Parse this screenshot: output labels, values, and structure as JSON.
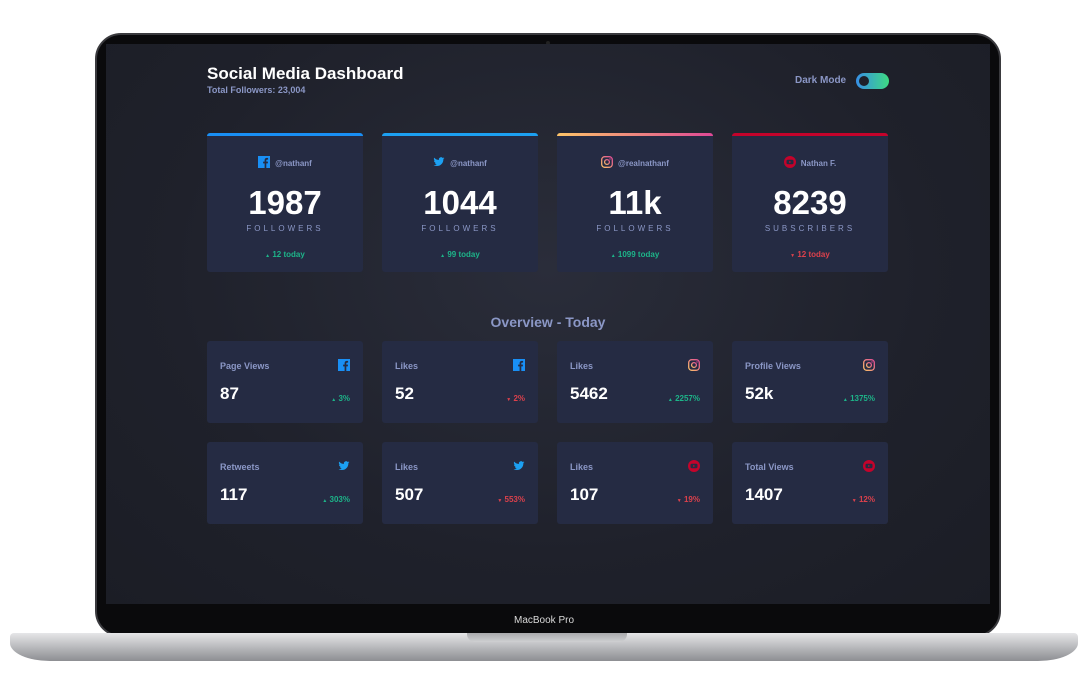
{
  "device": {
    "label": "MacBook Pro"
  },
  "header": {
    "title": "Social Media Dashboard",
    "total": "Total Followers: 23,004",
    "dark_mode_label": "Dark Mode",
    "dark_mode_on": true
  },
  "cards": [
    {
      "platform": "facebook",
      "handle": "@nathanf",
      "count": "1987",
      "label": "FOLLOWERS",
      "change": "12 today",
      "dir": "up",
      "accent": "#198ff5"
    },
    {
      "platform": "twitter",
      "handle": "@nathanf",
      "count": "1044",
      "label": "FOLLOWERS",
      "change": "99 today",
      "dir": "up",
      "accent": "#1ca0f2"
    },
    {
      "platform": "instagram",
      "handle": "@realnathanf",
      "count": "11k",
      "label": "FOLLOWERS",
      "change": "1099 today",
      "dir": "up",
      "accent": "#fdc468"
    },
    {
      "platform": "youtube",
      "handle": "Nathan F.",
      "count": "8239",
      "label": "SUBSCRIBERS",
      "change": "12 today",
      "dir": "down",
      "accent": "#c4032b"
    }
  ],
  "overview": {
    "title": "Overview - Today",
    "items": [
      {
        "name": "Page Views",
        "platform": "facebook",
        "value": "87",
        "change": "3%",
        "dir": "up"
      },
      {
        "name": "Likes",
        "platform": "facebook",
        "value": "52",
        "change": "2%",
        "dir": "down"
      },
      {
        "name": "Likes",
        "platform": "instagram",
        "value": "5462",
        "change": "2257%",
        "dir": "up"
      },
      {
        "name": "Profile Views",
        "platform": "instagram",
        "value": "52k",
        "change": "1375%",
        "dir": "up"
      },
      {
        "name": "Retweets",
        "platform": "twitter",
        "value": "117",
        "change": "303%",
        "dir": "up"
      },
      {
        "name": "Likes",
        "platform": "twitter",
        "value": "507",
        "change": "553%",
        "dir": "down"
      },
      {
        "name": "Likes",
        "platform": "youtube",
        "value": "107",
        "change": "19%",
        "dir": "down"
      },
      {
        "name": "Total Views",
        "platform": "youtube",
        "value": "1407",
        "change": "12%",
        "dir": "down"
      }
    ]
  }
}
